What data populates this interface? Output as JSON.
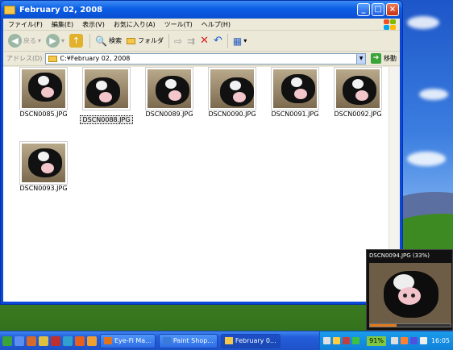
{
  "window": {
    "title": "February 02, 2008",
    "menu": [
      "ファイル(F)",
      "編集(E)",
      "表示(V)",
      "お気に入り(A)",
      "ツール(T)",
      "ヘルプ(H)"
    ],
    "toolbar": {
      "back": "戻る",
      "search": "検索",
      "folders": "フォルダ"
    },
    "address": {
      "label": "アドレス(D)",
      "value": "C:¥February 02, 2008",
      "go": "移動"
    }
  },
  "files": [
    {
      "name": "DSCN0085.JPG"
    },
    {
      "name": "DSCN0088.JPG",
      "selected": true
    },
    {
      "name": "DSCN0089.JPG"
    },
    {
      "name": "DSCN0090.JPG"
    },
    {
      "name": "DSCN0091.JPG"
    },
    {
      "name": "DSCN0092.JPG"
    },
    {
      "name": "DSCN0093.JPG"
    }
  ],
  "taskbar": {
    "buttons": [
      {
        "label": "Eye-Fi Ma...",
        "active": false
      },
      {
        "label": "Paint Shop...",
        "active": false
      },
      {
        "label": "February 0...",
        "active": true
      }
    ],
    "battery": "91%",
    "clock": "16:05"
  },
  "popup": {
    "title": "DSCN0094.JPG (33%)",
    "progress": 0.33
  },
  "colors": {
    "taskbar": "#245edb",
    "title_bar": "#0b5ee6",
    "progress_fill": "#e07a1c",
    "battery": "#7ec843"
  }
}
